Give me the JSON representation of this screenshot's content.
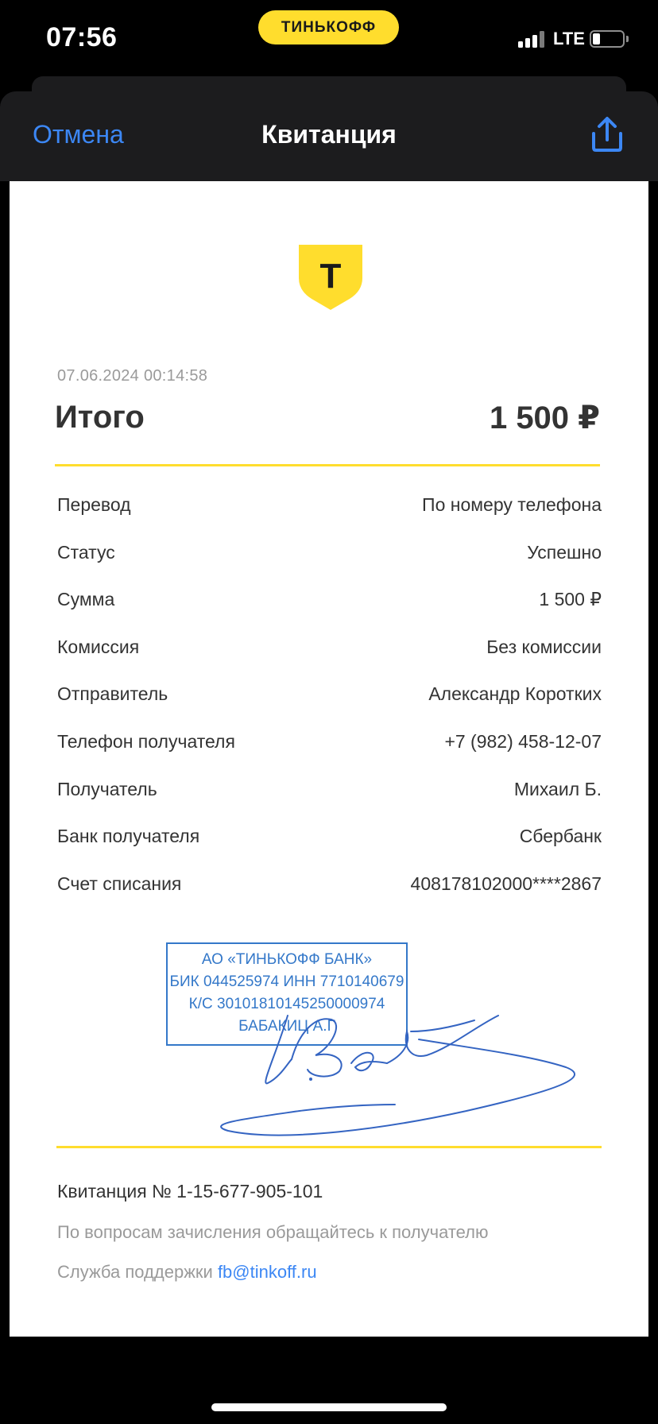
{
  "status_bar": {
    "time": "07:56",
    "carrier": "ТИНЬКОФФ",
    "network": "LTE",
    "battery_level": 0.2
  },
  "navbar": {
    "cancel_label": "Отмена",
    "title": "Квитанция",
    "share_icon": "share-icon"
  },
  "receipt": {
    "logo_letter": "Т",
    "datetime": "07.06.2024  00:14:58",
    "total_label": "Итого",
    "total_value": "1 500 ₽",
    "rows": [
      {
        "key": "Перевод",
        "value": "По номеру телефона"
      },
      {
        "key": "Статус",
        "value": "Успешно"
      },
      {
        "key": "Сумма",
        "value": "1 500 ₽"
      },
      {
        "key": "Комиссия",
        "value": "Без комиссии"
      },
      {
        "key": "Отправитель",
        "value": "Александр Коротких"
      },
      {
        "key": "Телефон получателя",
        "value": "+7 (982) 458-12-07"
      },
      {
        "key": "Получатель",
        "value": "Михаил Б."
      },
      {
        "key": "Банк получателя",
        "value": "Сбербанк"
      },
      {
        "key": "Счет списания",
        "value": "408178102000****2867"
      }
    ],
    "stamp": {
      "line1": "АО «ТИНЬКОФФ БАНК»",
      "line2": "БИК 044525974 ИНН 7710140679",
      "line3": "К/С 30101810145250000974",
      "line4": "БАБАКИЦ А.Г"
    },
    "receipt_number": "Квитанция  № 1-15-677-905-101",
    "note": "По вопросам зачисления обращайтесь к получателю",
    "support_label": "Служба поддержки ",
    "support_email": "fb@tinkoff.ru"
  },
  "colors": {
    "brand_yellow": "#ffdd2d",
    "link_blue": "#3c87f4",
    "stamp_blue": "#3478c9"
  }
}
